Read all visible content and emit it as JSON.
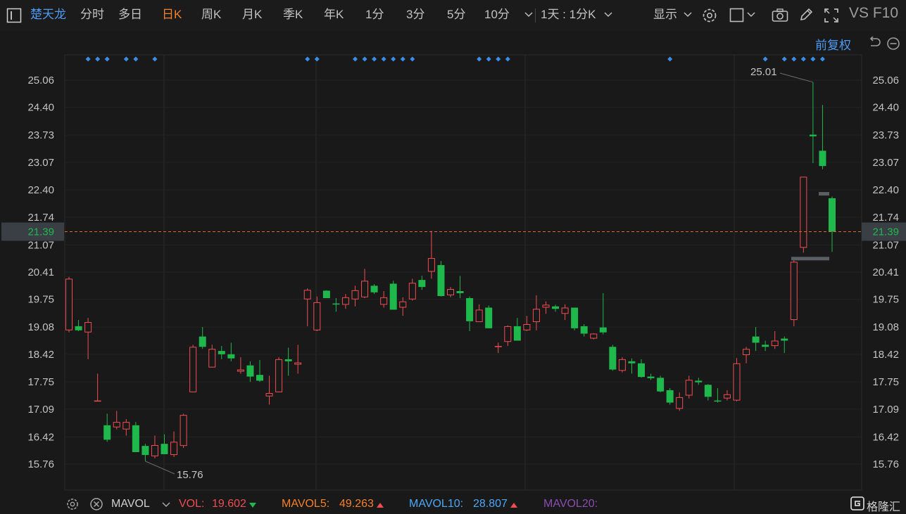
{
  "toolbar": {
    "stock_name": "楚天龙",
    "tabs": [
      "分时",
      "多日",
      "日K",
      "周K",
      "月K",
      "季K",
      "年K",
      "1分",
      "3分",
      "5分",
      "10分"
    ],
    "active_tab": "日K",
    "period_select": "1天 : 1分K",
    "display_label": "显示",
    "right_text": "VS F10",
    "fq_label": "前复权",
    "icons": [
      "sidebar-icon",
      "chevron-down-icon",
      "settings-icon",
      "square-icon",
      "camera-icon",
      "pencil-icon",
      "expand-icon",
      "undo-icon",
      "minus-circle-icon"
    ]
  },
  "chart_data": {
    "type": "candlestick",
    "y_ticks": [
      "25.06",
      "24.40",
      "23.73",
      "23.07",
      "22.40",
      "21.74",
      "21.07",
      "20.41",
      "19.75",
      "19.08",
      "18.42",
      "17.75",
      "17.09",
      "16.42",
      "15.76"
    ],
    "ylim": [
      15.76,
      25.06
    ],
    "current_price": "21.39",
    "high_label": "25.01",
    "low_label": "15.76",
    "colors": {
      "up": "#ef4d52",
      "down": "#1fb84c",
      "current_line": "#e0672f",
      "marker": "#3a8ee8"
    },
    "candles": [
      {
        "o": 19.0,
        "h": 20.3,
        "l": 18.95,
        "c": 20.25
      },
      {
        "o": 19.1,
        "h": 19.25,
        "l": 18.98,
        "c": 19.0
      },
      {
        "o": 18.95,
        "h": 19.3,
        "l": 18.3,
        "c": 19.2
      },
      {
        "o": 17.3,
        "h": 17.95,
        "l": 17.28,
        "c": 17.3
      },
      {
        "o": 16.7,
        "h": 16.98,
        "l": 16.3,
        "c": 16.35
      },
      {
        "o": 16.65,
        "h": 17.05,
        "l": 16.6,
        "c": 16.78
      },
      {
        "o": 16.6,
        "h": 16.85,
        "l": 16.45,
        "c": 16.78
      },
      {
        "o": 16.7,
        "h": 16.78,
        "l": 16.05,
        "c": 16.05
      },
      {
        "o": 16.2,
        "h": 16.25,
        "l": 15.83,
        "c": 15.98
      },
      {
        "o": 15.95,
        "h": 16.45,
        "l": 15.9,
        "c": 16.22
      },
      {
        "o": 16.25,
        "h": 16.48,
        "l": 16.0,
        "c": 16.0
      },
      {
        "o": 15.98,
        "h": 16.55,
        "l": 15.93,
        "c": 16.3
      },
      {
        "o": 16.2,
        "h": 16.98,
        "l": 16.15,
        "c": 16.95
      },
      {
        "o": 17.5,
        "h": 18.65,
        "l": 17.5,
        "c": 18.6
      },
      {
        "o": 18.85,
        "h": 19.08,
        "l": 18.55,
        "c": 18.6
      },
      {
        "o": 18.1,
        "h": 18.65,
        "l": 18.1,
        "c": 18.55
      },
      {
        "o": 18.5,
        "h": 18.62,
        "l": 18.3,
        "c": 18.42
      },
      {
        "o": 18.42,
        "h": 18.7,
        "l": 18.25,
        "c": 18.32
      },
      {
        "o": 18.0,
        "h": 18.35,
        "l": 17.95,
        "c": 18.05
      },
      {
        "o": 18.15,
        "h": 18.25,
        "l": 17.75,
        "c": 17.88
      },
      {
        "o": 17.92,
        "h": 18.28,
        "l": 17.75,
        "c": 17.78
      },
      {
        "o": 17.4,
        "h": 17.9,
        "l": 17.2,
        "c": 17.48
      },
      {
        "o": 17.5,
        "h": 18.35,
        "l": 17.5,
        "c": 18.3
      },
      {
        "o": 18.3,
        "h": 18.58,
        "l": 17.9,
        "c": 18.25
      },
      {
        "o": 18.17,
        "h": 18.65,
        "l": 17.95,
        "c": 18.22
      },
      {
        "o": 19.75,
        "h": 20.02,
        "l": 19.1,
        "c": 19.98
      },
      {
        "o": 19.0,
        "h": 19.82,
        "l": 18.98,
        "c": 19.68
      },
      {
        "o": 19.96,
        "h": 19.97,
        "l": 19.78,
        "c": 19.78
      },
      {
        "o": 19.65,
        "h": 19.78,
        "l": 19.45,
        "c": 19.63
      },
      {
        "o": 19.62,
        "h": 19.88,
        "l": 19.52,
        "c": 19.8
      },
      {
        "o": 19.75,
        "h": 20.08,
        "l": 19.58,
        "c": 19.97
      },
      {
        "o": 19.8,
        "h": 20.49,
        "l": 19.78,
        "c": 20.2
      },
      {
        "o": 20.08,
        "h": 20.12,
        "l": 19.88,
        "c": 19.92
      },
      {
        "o": 19.62,
        "h": 19.95,
        "l": 19.55,
        "c": 19.8
      },
      {
        "o": 20.13,
        "h": 20.2,
        "l": 19.5,
        "c": 19.5
      },
      {
        "o": 19.55,
        "h": 19.8,
        "l": 19.35,
        "c": 19.7
      },
      {
        "o": 19.75,
        "h": 20.25,
        "l": 19.72,
        "c": 20.15
      },
      {
        "o": 20.22,
        "h": 20.32,
        "l": 19.98,
        "c": 20.05
      },
      {
        "o": 20.42,
        "h": 21.41,
        "l": 20.25,
        "c": 20.75
      },
      {
        "o": 20.58,
        "h": 20.68,
        "l": 19.82,
        "c": 19.83
      },
      {
        "o": 19.85,
        "h": 20.05,
        "l": 19.8,
        "c": 20.0
      },
      {
        "o": 19.95,
        "h": 20.32,
        "l": 19.78,
        "c": 19.9
      },
      {
        "o": 19.78,
        "h": 19.82,
        "l": 18.98,
        "c": 19.22
      },
      {
        "o": 19.2,
        "h": 19.63,
        "l": 19.2,
        "c": 19.5
      },
      {
        "o": 19.55,
        "h": 19.6,
        "l": 19.05,
        "c": 19.05
      },
      {
        "o": 18.62,
        "h": 18.7,
        "l": 18.45,
        "c": 18.62
      },
      {
        "o": 18.72,
        "h": 19.12,
        "l": 18.62,
        "c": 19.1
      },
      {
        "o": 19.1,
        "h": 19.3,
        "l": 18.75,
        "c": 18.75
      },
      {
        "o": 19.0,
        "h": 19.35,
        "l": 18.98,
        "c": 19.15
      },
      {
        "o": 19.2,
        "h": 19.85,
        "l": 19.0,
        "c": 19.52
      },
      {
        "o": 19.55,
        "h": 19.7,
        "l": 19.4,
        "c": 19.62
      },
      {
        "o": 19.58,
        "h": 19.62,
        "l": 19.45,
        "c": 19.52
      },
      {
        "o": 19.4,
        "h": 19.63,
        "l": 19.25,
        "c": 19.55
      },
      {
        "o": 19.55,
        "h": 19.55,
        "l": 19.0,
        "c": 19.05
      },
      {
        "o": 19.1,
        "h": 19.15,
        "l": 18.85,
        "c": 18.92
      },
      {
        "o": 18.8,
        "h": 18.93,
        "l": 18.78,
        "c": 18.92
      },
      {
        "o": 19.07,
        "h": 19.9,
        "l": 18.9,
        "c": 18.95
      },
      {
        "o": 18.6,
        "h": 18.65,
        "l": 18.02,
        "c": 18.05
      },
      {
        "o": 18.02,
        "h": 18.35,
        "l": 17.98,
        "c": 18.3
      },
      {
        "o": 18.25,
        "h": 18.32,
        "l": 17.95,
        "c": 18.2
      },
      {
        "o": 18.2,
        "h": 18.3,
        "l": 17.85,
        "c": 17.87
      },
      {
        "o": 17.88,
        "h": 17.95,
        "l": 17.8,
        "c": 17.84
      },
      {
        "o": 17.85,
        "h": 17.9,
        "l": 17.5,
        "c": 17.52
      },
      {
        "o": 17.55,
        "h": 17.6,
        "l": 17.2,
        "c": 17.25
      },
      {
        "o": 17.1,
        "h": 17.5,
        "l": 17.05,
        "c": 17.38
      },
      {
        "o": 17.42,
        "h": 17.9,
        "l": 17.35,
        "c": 17.8
      },
      {
        "o": 17.78,
        "h": 17.85,
        "l": 17.68,
        "c": 17.74
      },
      {
        "o": 17.68,
        "h": 17.7,
        "l": 17.3,
        "c": 17.39
      },
      {
        "o": 17.3,
        "h": 17.6,
        "l": 17.25,
        "c": 17.28
      },
      {
        "o": 17.35,
        "h": 17.55,
        "l": 17.3,
        "c": 17.45
      },
      {
        "o": 17.3,
        "h": 18.33,
        "l": 17.28,
        "c": 18.2
      },
      {
        "o": 18.4,
        "h": 18.6,
        "l": 18.2,
        "c": 18.55
      },
      {
        "o": 18.85,
        "h": 19.08,
        "l": 18.5,
        "c": 18.7
      },
      {
        "o": 18.65,
        "h": 18.75,
        "l": 18.5,
        "c": 18.6
      },
      {
        "o": 18.62,
        "h": 18.98,
        "l": 18.55,
        "c": 18.75
      },
      {
        "o": 18.8,
        "h": 18.85,
        "l": 18.45,
        "c": 18.75
      },
      {
        "o": 19.25,
        "h": 20.75,
        "l": 19.1,
        "c": 20.66
      },
      {
        "o": 21.0,
        "h": 22.72,
        "l": 20.88,
        "c": 22.72
      },
      {
        "o": 23.74,
        "h": 25.01,
        "l": 23.05,
        "c": 23.7
      },
      {
        "o": 23.35,
        "h": 24.46,
        "l": 22.9,
        "c": 22.98
      },
      {
        "o": 22.2,
        "h": 22.24,
        "l": 20.9,
        "c": 21.39
      }
    ],
    "markers_idx": [
      2,
      3,
      4,
      6,
      7,
      9,
      25,
      26,
      30,
      31,
      32,
      33,
      34,
      35,
      36,
      43,
      44,
      45,
      46,
      63,
      73,
      75,
      76,
      77,
      78,
      79
    ]
  },
  "bottom": {
    "indicator": "MAVOL",
    "vol_label": "VOL:",
    "vol_value": "19.602",
    "mavol5_label": "MAVOL5:",
    "mavol5_value": "49.263",
    "mavol10_label": "MAVOL10:",
    "mavol10_value": "28.807",
    "mavol20_label": "MAVOL20:",
    "brand": "格隆汇",
    "colors": {
      "vol": "#ef4d52",
      "mavol5": "#f5802a",
      "mavol10": "#4da6f5",
      "mavol20": "#8a4db0"
    }
  }
}
